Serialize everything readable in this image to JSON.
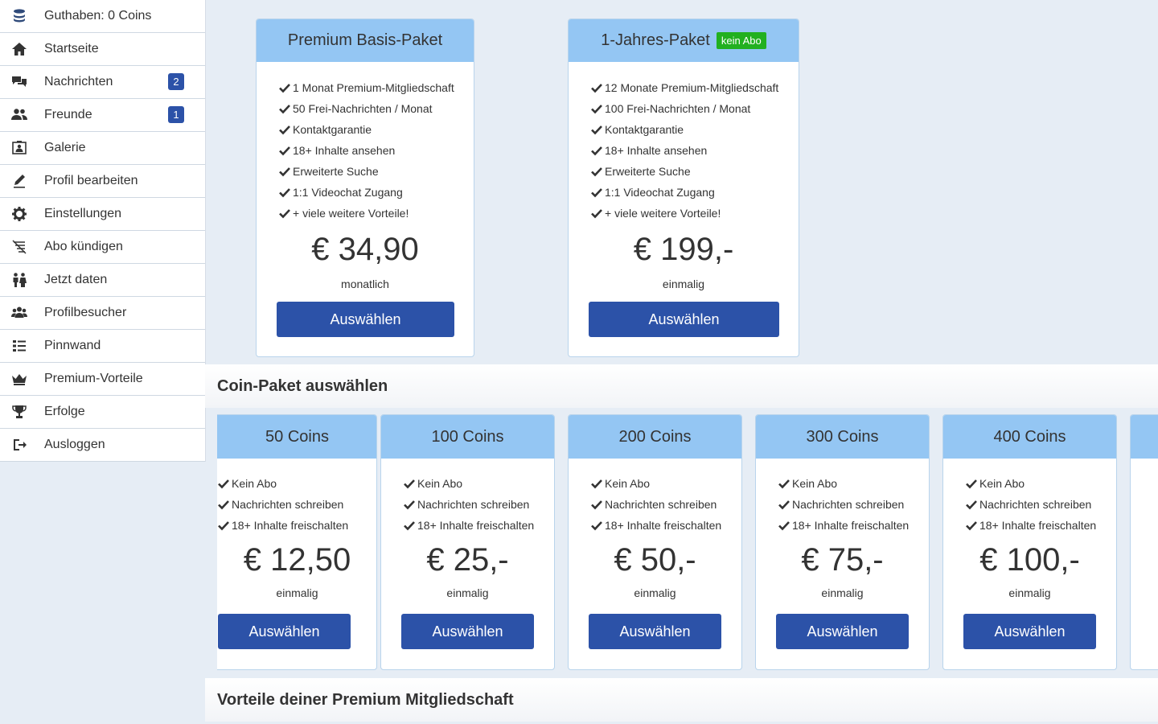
{
  "sidebar": {
    "items": [
      {
        "label": "Guthaben: 0 Coins",
        "icon": "coins-icon"
      },
      {
        "label": "Startseite",
        "icon": "home-icon"
      },
      {
        "label": "Nachrichten",
        "icon": "chat-icon",
        "badge": "2"
      },
      {
        "label": "Freunde",
        "icon": "friends-icon",
        "badge": "1"
      },
      {
        "label": "Galerie",
        "icon": "gallery-icon"
      },
      {
        "label": "Profil bearbeiten",
        "icon": "edit-icon"
      },
      {
        "label": "Einstellungen",
        "icon": "gear-icon"
      },
      {
        "label": "Abo kündigen",
        "icon": "cancel-list-icon"
      },
      {
        "label": "Jetzt daten",
        "icon": "couple-icon"
      },
      {
        "label": "Profilbesucher",
        "icon": "visitors-icon"
      },
      {
        "label": "Pinnwand",
        "icon": "list-icon"
      },
      {
        "label": "Premium-Vorteile",
        "icon": "crown-icon"
      },
      {
        "label": "Erfolge",
        "icon": "trophy-icon"
      },
      {
        "label": "Ausloggen",
        "icon": "logout-icon"
      }
    ]
  },
  "premium": {
    "packages": [
      {
        "title": "Premium Basis-Paket",
        "tag": "",
        "features": [
          "1 Monat Premium-Mitgliedschaft",
          "50 Frei-Nachrichten / Monat",
          "Kontaktgarantie",
          "18+ Inhalte ansehen",
          "Erweiterte Suche",
          "1:1 Videochat Zugang",
          "+ viele weitere Vorteile!"
        ],
        "price": "€ 34,90",
        "period": "monatlich",
        "button": "Auswählen"
      },
      {
        "title": "1-Jahres-Paket",
        "tag": "kein Abo",
        "features": [
          "12 Monate Premium-Mitgliedschaft",
          "100 Frei-Nachrichten / Monat",
          "Kontaktgarantie",
          "18+ Inhalte ansehen",
          "Erweiterte Suche",
          "1:1 Videochat Zugang",
          "+ viele weitere Vorteile!"
        ],
        "price": "€ 199,-",
        "period": "einmalig",
        "button": "Auswählen"
      }
    ]
  },
  "coins": {
    "heading": "Coin-Paket auswählen",
    "packages": [
      {
        "title": "50 Coins",
        "features": [
          "Kein Abo",
          "Nachrichten schreiben",
          "18+ Inhalte freischalten"
        ],
        "price": "€ 12,50",
        "period": "einmalig",
        "button": "Auswählen"
      },
      {
        "title": "100 Coins",
        "features": [
          "Kein Abo",
          "Nachrichten schreiben",
          "18+ Inhalte freischalten"
        ],
        "price": "€ 25,-",
        "period": "einmalig",
        "button": "Auswählen"
      },
      {
        "title": "200 Coins",
        "features": [
          "Kein Abo",
          "Nachrichten schreiben",
          "18+ Inhalte freischalten"
        ],
        "price": "€ 50,-",
        "period": "einmalig",
        "button": "Auswählen"
      },
      {
        "title": "300 Coins",
        "features": [
          "Kein Abo",
          "Nachrichten schreiben",
          "18+ Inhalte freischalten"
        ],
        "price": "€ 75,-",
        "period": "einmalig",
        "button": "Auswählen"
      },
      {
        "title": "400 Coins",
        "features": [
          "Kein Abo",
          "Nachrichten schreiben",
          "18+ Inhalte freischalten"
        ],
        "price": "€ 100,-",
        "period": "einmalig",
        "button": "Auswählen"
      }
    ]
  },
  "benefits": {
    "heading": "Vorteile deiner Premium Mitgliedschaft"
  },
  "colors": {
    "accent": "#2c52a8",
    "card_header": "#94c6f3",
    "tag": "#22b020",
    "background": "#e6edf5"
  }
}
